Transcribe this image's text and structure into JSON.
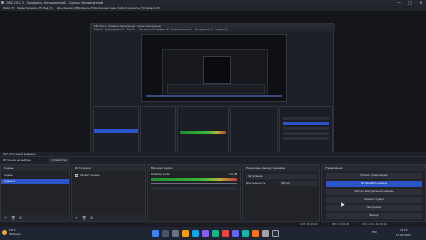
{
  "window": {
    "title": "OBS 29.1.3 - Профиль: Безымянный - Сцены: Безымянный",
    "controls": [
      "—",
      "□",
      "✕"
    ]
  },
  "menu": [
    "Файл (F)",
    "Редактировать (E)",
    "Вид (V)",
    "Док-панели (D)",
    "Профиль (P)",
    "Коллекция сцен (S)",
    "Инструменты (T)",
    "Справка (H)"
  ],
  "inner": {
    "title": "OBS 29.1.3 - Профиль: Безымянный - Сцены: Безымянный",
    "menu": [
      "Файл (F)",
      "Редактировать (E)",
      "Вид (V)",
      "Док-панели (D)",
      "Профиль (P)",
      "Коллекция сцен (S)",
      "Инструменты (T)",
      "Справка (H)"
    ]
  },
  "status_preview": "Нет источника выбрано",
  "switchbar": {
    "label": "Источник не выбран",
    "props_button": "⚙ Свойства"
  },
  "docks": {
    "scenes": {
      "title": "Сцены",
      "items": [
        "Сцена",
        "Сцена 2"
      ],
      "selected_index": 1
    },
    "sources": {
      "title": "Источники",
      "items": [
        "Захват экрана"
      ]
    },
    "mixer": {
      "title": "Микшер аудио",
      "channel": "Desktop Audio",
      "level": "0.0 dB"
    },
    "transitions": {
      "title": "Переходы между сценами",
      "type": "Затухание",
      "duration_label": "Длительность",
      "duration": "300 мс"
    },
    "controls": {
      "title": "Управление",
      "buttons": [
        "Начать трансляцию",
        "Остановить запись",
        "Запуск виртуальной камеры",
        "Режим студии",
        "Настройки",
        "Выход"
      ],
      "active_index": 1
    }
  },
  "statusline": {
    "live": "LIVE: 00:00:00",
    "rec": "REC: 00:00:28",
    "cpu": "CPU: 2.1%, 60.00 fps"
  },
  "taskbar": {
    "weather_temp": "18°C",
    "weather_desc": "Облачно",
    "lang": "РУС",
    "time": "14:25",
    "date": "17.09.2023"
  },
  "colors": {
    "accent": "#2c54c8",
    "background": "#1b1d24",
    "panel": "#212329"
  }
}
